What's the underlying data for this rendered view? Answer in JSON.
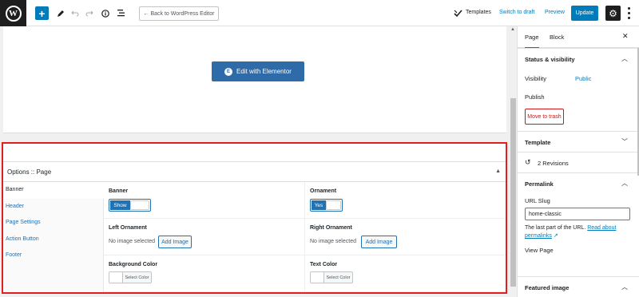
{
  "toolbar": {
    "logo": "W",
    "back_label": "← Back to WordPress Editor",
    "templates_label": "Templates",
    "switch_draft_label": "Switch to draft",
    "preview_label": "Preview",
    "update_label": "Update",
    "icons": [
      "wordpress-logo",
      "plus-icon",
      "pencil-icon",
      "undo-icon",
      "redo-icon",
      "info-icon",
      "list-view-icon",
      "templates-icon",
      "gear-icon",
      "more-vertical-icon"
    ],
    "accent_color": "#007cba"
  },
  "editor": {
    "elementor_label": "Edit with Elementor"
  },
  "metabox": {
    "title": "Options :: Page",
    "tabs": [
      {
        "label": "Banner",
        "active": true
      },
      {
        "label": "Header",
        "active": false
      },
      {
        "label": "Page Settings",
        "active": false
      },
      {
        "label": "Action Button",
        "active": false
      },
      {
        "label": "Footer",
        "active": false
      }
    ],
    "fields": {
      "banner": {
        "label": "Banner",
        "value": "Show"
      },
      "ornament": {
        "label": "Ornament",
        "value": "Yes"
      },
      "left_ornament": {
        "label": "Left Ornament",
        "status": "No image selected",
        "button": "Add Image"
      },
      "right_ornament": {
        "label": "Right Ornament",
        "status": "No image selected",
        "button": "Add Image"
      },
      "background_color": {
        "label": "Background Color",
        "button": "Select Color"
      },
      "text_color": {
        "label": "Text Color",
        "button": "Select Color"
      }
    },
    "highlight_color": "#e02020"
  },
  "sidebar": {
    "tab_page": "Page",
    "tab_block": "Block",
    "status_title": "Status & visibility",
    "visibility_label": "Visibility",
    "visibility_value": "Public",
    "publish_label": "Publish",
    "trash_label": "Move to trash",
    "template_title": "Template",
    "revisions_label": "2 Revisions",
    "permalink_title": "Permalink",
    "url_slug_label": "URL Slug",
    "url_slug_value": "home-classic",
    "hint_text": "The last part of the URL.",
    "hint_link": "Read about permalinks",
    "view_page_label": "View Page",
    "featured_title": "Featured image"
  }
}
